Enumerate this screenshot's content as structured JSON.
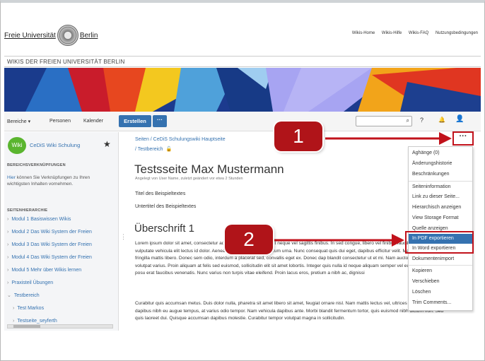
{
  "header": {
    "logo_left": "Freie Universität",
    "logo_right": "Berlin",
    "links": [
      "Wikis-Home",
      "Wikis-Hilfe",
      "Wikis-FAQ",
      "Nutzungsbedingungen"
    ]
  },
  "banner_title": "WIKIS DER FREIEN UNIVERSITÄT BERLIN",
  "nav": {
    "bereiche": "Bereiche ▾",
    "personen": "Personen",
    "kalender": "Kalender",
    "create": "Erstellen",
    "more": "···",
    "search_icon": "⌕",
    "help": "?",
    "notify": "🔔",
    "user": "👤"
  },
  "sidebar": {
    "logo_text": "Wiki",
    "space_name": "CeDiS Wiki Schulung",
    "section_links": "BEREICHSVERKNÜPFUNGEN",
    "text_link": "Hier",
    "text_rest": " können Sie Verknüpfungen zu Ihren wichtigsten Inhalten vornehmen.",
    "section_tree": "SEITENHIERARCHIE",
    "tree": [
      {
        "chev": "›",
        "label": "Modul 1 Basiswissen Wikis"
      },
      {
        "chev": "›",
        "label": "Modul 2 Das Wiki System der Freien"
      },
      {
        "chev": "›",
        "label": "Modul 3 Das Wiki System der Freien"
      },
      {
        "chev": "›",
        "label": "Modul 4 Das Wiki System der Freien"
      },
      {
        "chev": "›",
        "label": "Modul 5 Mehr über Wikis lernen"
      },
      {
        "chev": "›",
        "label": "Praxisteil Übungen"
      },
      {
        "chev": "⌄",
        "label": "Testbereich"
      },
      {
        "chev": "›",
        "label": "Test Markos"
      },
      {
        "chev": "›",
        "label": "Testseite_seyferth"
      }
    ]
  },
  "content": {
    "crumb1": "Seiten / CeDiS Schulungswiki Hauptseite",
    "crumb2": "/ Testbereich",
    "title": "Testsseite Max Mustermann",
    "meta": "Angelegt von User Name, zuletzt geändert vor etwa 2 Stunden",
    "p1": "Titel des Beispieltextes",
    "p2": "Untertitel des Beispieltextes",
    "heading": "Überschrift 1",
    "body1": "Lorem ipsum dolor sit amet, consectetur adipiscing elit. Duis suscipit neque vel sagittis finibus. In sed congue, libero vel finibus faucibus, metus metus vulputate vehicula elit lectus id dolor. Aenean in erat id, pulvinar rutrum urna. Nunc consequat quis dui eget, dapibus efficitur velit. Mauris fe accumsan eu, fringilla mattis libero. Donec sem odio, interdum a placerat sed, convallis eget ex. Donec dap blandit consectetur ut et mi. Nam auctor neque ut enim volutpat varius. Proin aliquam at felis sed euismod, sollicitudin elit sit amet lobortis. Integer quis nulla id neque aliquam semper vel eu nisl. Morbi aliquam posu erat faucibus venenatis. Nunc varius non turpis vitae eleifend. Proin lacus eros, pretium a nibh ac, dignissi",
    "body2": "Curabitur quis accumsan metus. Duis dolor nulla, pharetra sit amet libero sit amet, feugiat ornare nisl. Nam mattis lectus vel, ultrices felis. Phasellus dapibus nibh eu augue tempus, at varius odio tempor. Nam vehicula dapibus ante. Morbi blandit fermentum tortor, quis euismod nibh dictum non. Sed quis laoreet dui. Quisque accumsan dapibus molestie. Curabitur tempor volutpat magna in sollicitudin."
  },
  "menu_button": "···",
  "menu": [
    "Aghänge (0)",
    "Änderungshistorie",
    "Beschränkungen",
    "Seiteninformation",
    "Link zu dieser Seite...",
    "Hierarchisch anzeigen",
    "View Storage Format",
    "Quelle anzeigen",
    "In PDF exportieren",
    "In Word exportieren",
    "Dokumentenimport",
    "Kopieren",
    "Verschieben",
    "Löschen",
    "Trim Comments..."
  ],
  "badges": [
    "1",
    "2"
  ],
  "colors": {
    "accent": "#3572b0",
    "highlight": "#c1121b",
    "badge": "#b01419"
  }
}
